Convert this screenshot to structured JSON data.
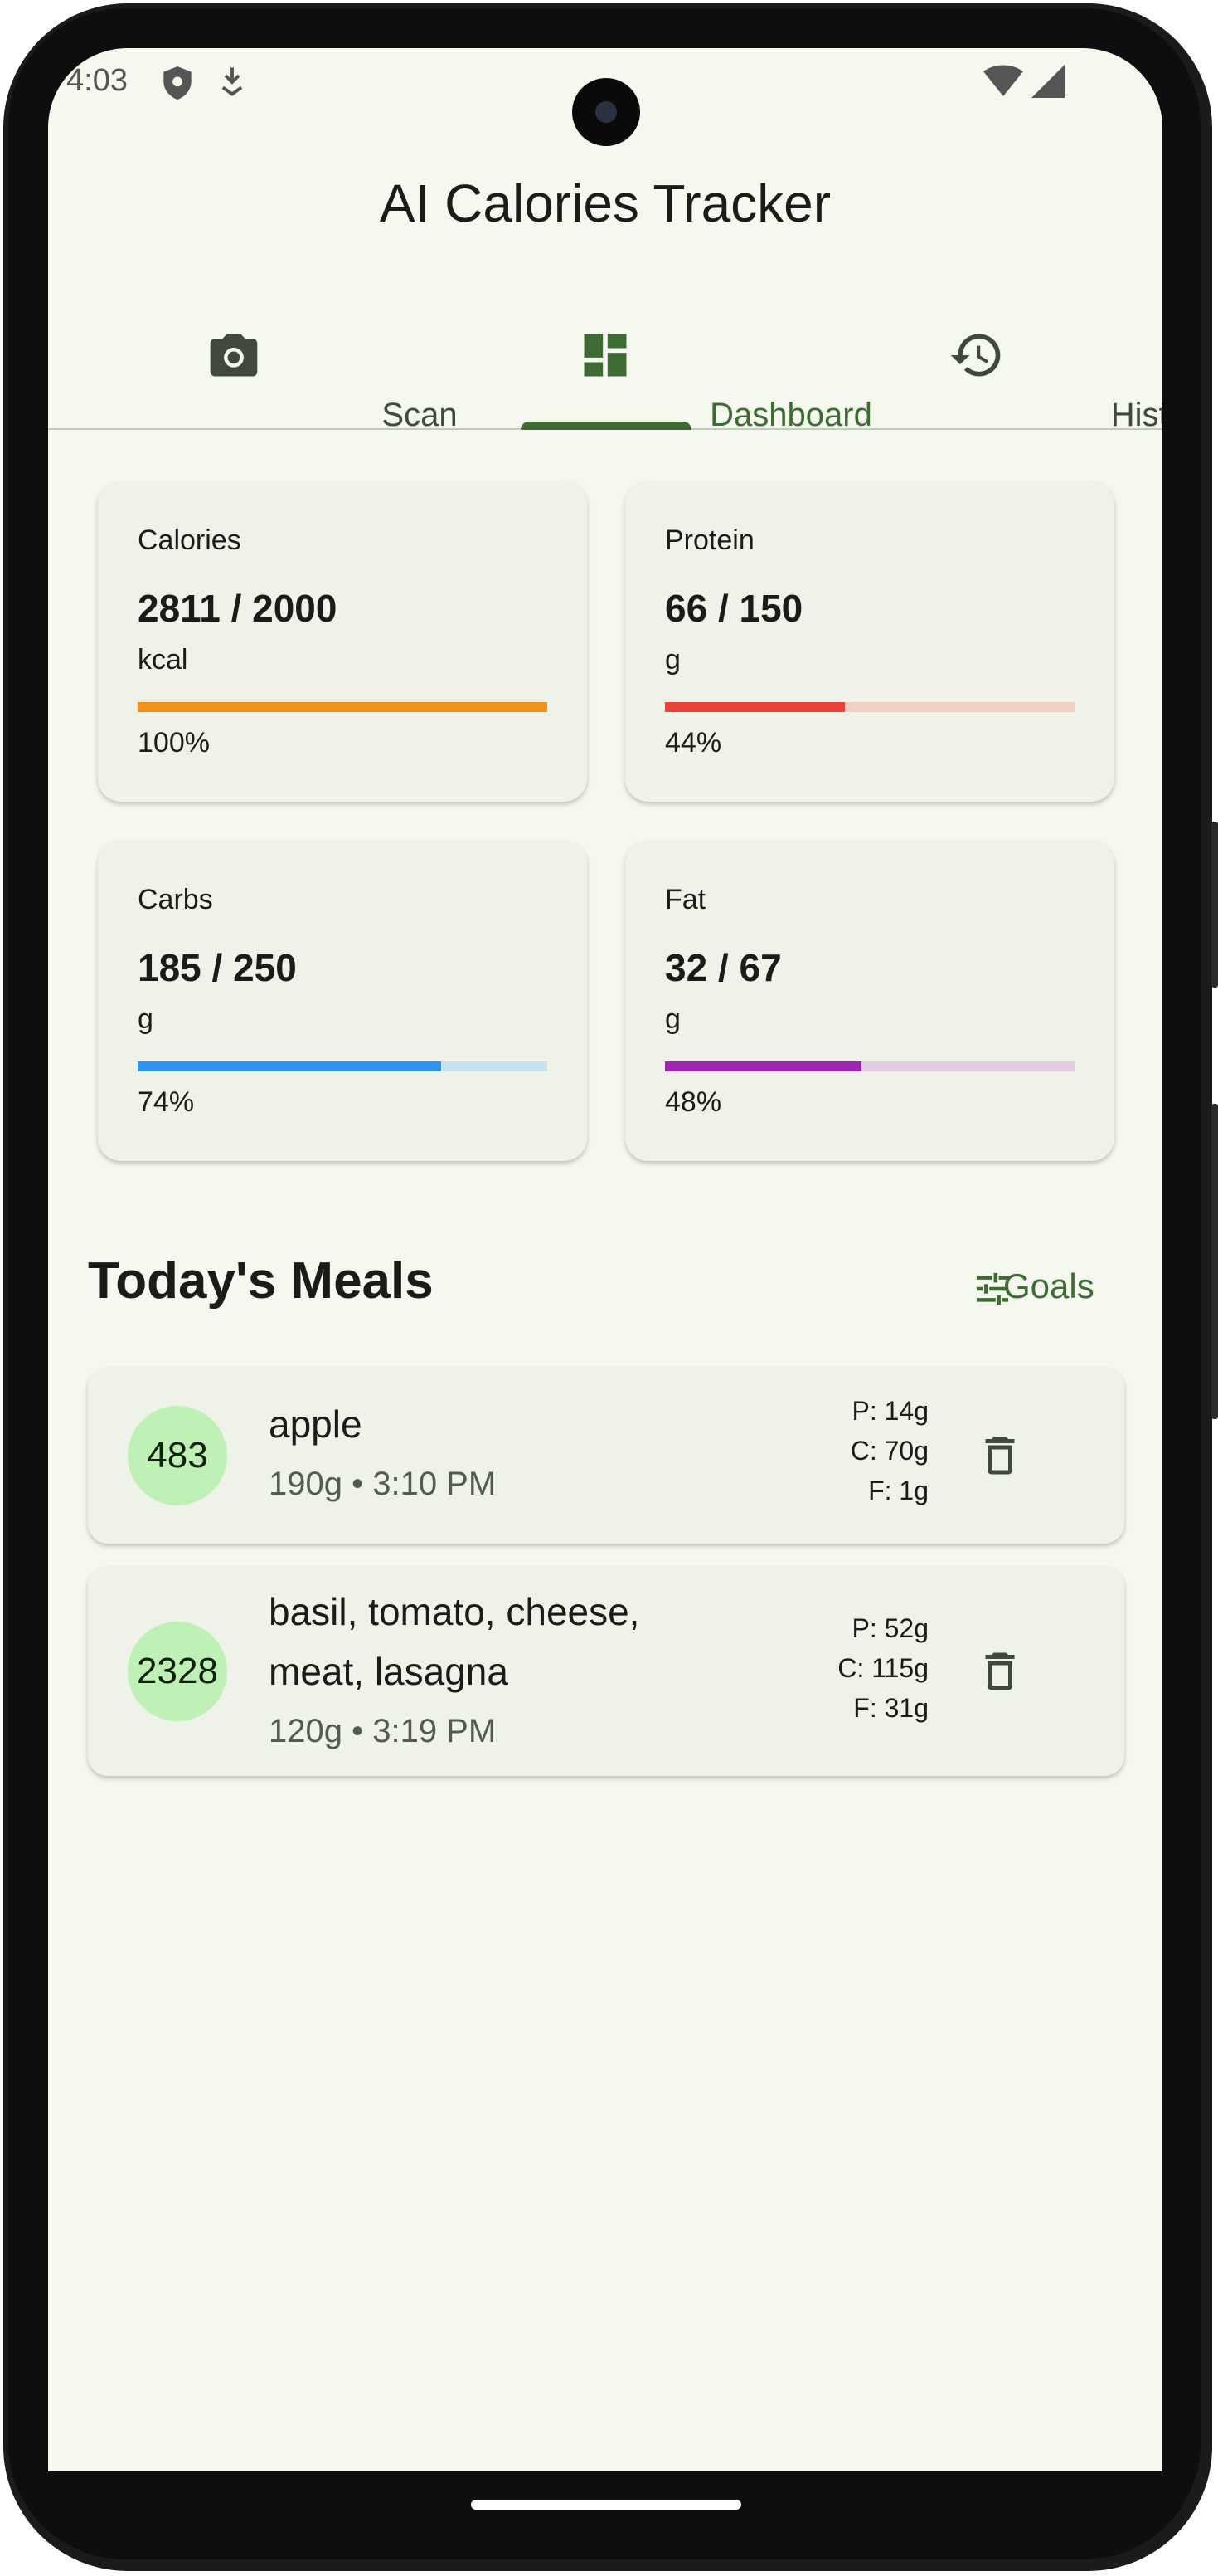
{
  "status": {
    "time": "4:03"
  },
  "app": {
    "title": "AI Calories Tracker"
  },
  "tabs": [
    {
      "label": "Scan",
      "icon": "camera-icon",
      "active": false
    },
    {
      "label": "Dashboard",
      "icon": "dashboard-icon",
      "active": true
    },
    {
      "label": "History",
      "icon": "history-icon",
      "active": false
    }
  ],
  "stats": [
    {
      "label": "Calories",
      "value": "2811 / 2000",
      "unit": "kcal",
      "percent_label": "100%",
      "progress": 1.0,
      "color": "#f39218",
      "track_color": "#f39218"
    },
    {
      "label": "Protein",
      "value": "66 / 150",
      "unit": "g",
      "percent_label": "44%",
      "progress": 0.44,
      "color": "#e8423a",
      "track_color": "#f2d0c5"
    },
    {
      "label": "Carbs",
      "value": "185 / 250",
      "unit": "g",
      "percent_label": "74%",
      "progress": 0.74,
      "color": "#2f95ee",
      "track_color": "#c9e3ee"
    },
    {
      "label": "Fat",
      "value": "32 / 67",
      "unit": "g",
      "percent_label": "48%",
      "progress": 0.48,
      "color": "#9c27b0",
      "track_color": "#e2cce0"
    }
  ],
  "meals_section": {
    "title": "Today's Meals",
    "goals_label": "Goals"
  },
  "meals": [
    {
      "kcal": "483",
      "name_lines": [
        "apple"
      ],
      "detail": "190g • 3:10 PM",
      "protein": "P: 14g",
      "carbs": "C: 70g",
      "fat": "F: 1g"
    },
    {
      "kcal": "2328",
      "name_lines": [
        "basil, tomato, cheese,",
        "meat, lasagna"
      ],
      "detail": "120g • 3:19 PM",
      "protein": "P: 52g",
      "carbs": "C: 115g",
      "fat": "F: 31g"
    }
  ],
  "colors": {
    "accent": "#3e6b33",
    "background": "#f5f8ef",
    "card": "#eff2e8",
    "kcal_badge": "#bff0b5"
  }
}
